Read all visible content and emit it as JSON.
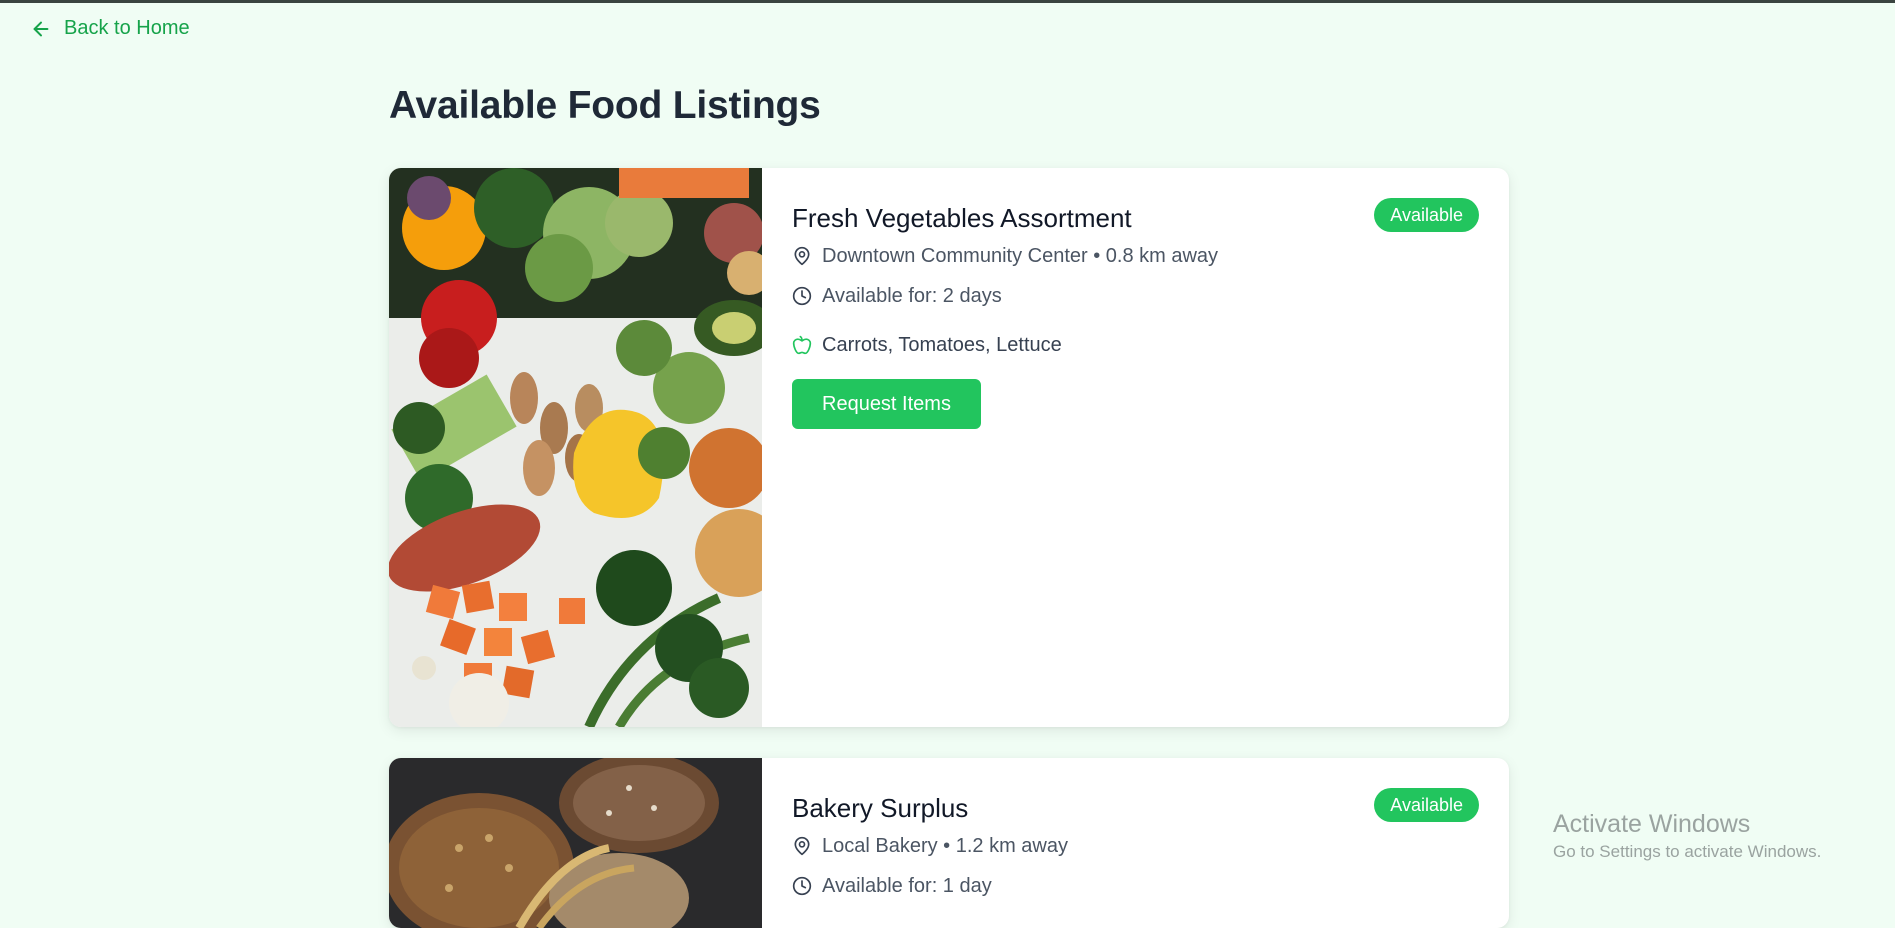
{
  "nav": {
    "back_label": "Back to Home"
  },
  "page": {
    "title": "Available Food Listings"
  },
  "listings": [
    {
      "title": "Fresh Vegetables Assortment",
      "status": "Available",
      "location": "Downtown Community Center • 0.8 km away",
      "availability": "Available for: 2 days",
      "items": "Carrots, Tomatoes, Lettuce",
      "request_label": "Request Items",
      "image_icon": "vegetables-photo"
    },
    {
      "title": "Bakery Surplus",
      "status": "Available",
      "location": "Local Bakery • 1.2 km away",
      "availability": "Available for: 1 day",
      "image_icon": "bread-photo"
    }
  ],
  "watermark": {
    "line1": "Activate Windows",
    "line2": "Go to Settings to activate Windows."
  },
  "colors": {
    "background": "#f0fdf4",
    "accent": "#22c55e",
    "link": "#16a34a",
    "title": "#1f2937"
  }
}
